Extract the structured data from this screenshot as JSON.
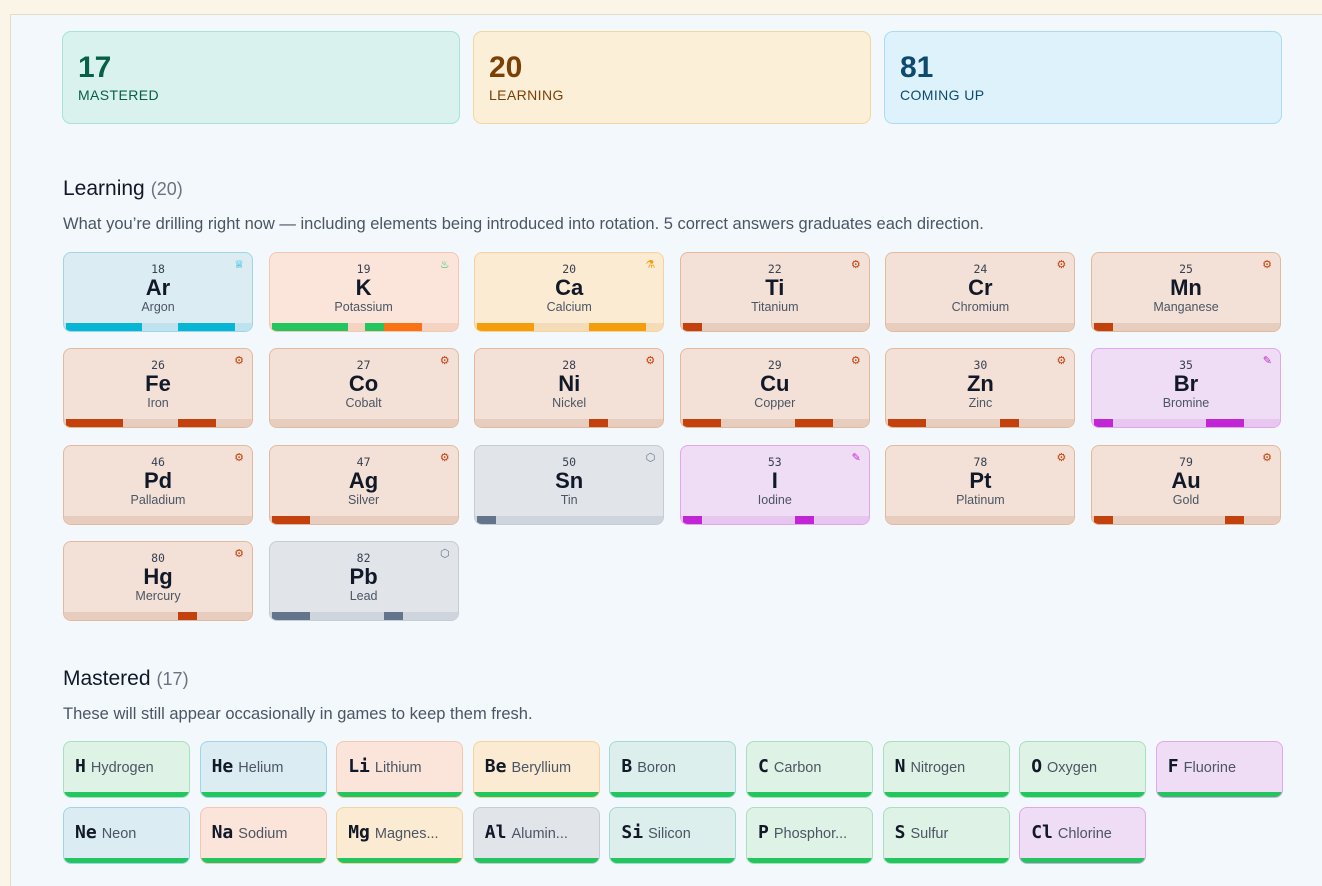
{
  "stats": [
    {
      "value": "17",
      "label": "MASTERED",
      "bg": "#d9f2ee",
      "border": "#a7e3d8",
      "fg": "#065f46"
    },
    {
      "value": "20",
      "label": "LEARNING",
      "bg": "#fcefd7",
      "border": "#f4d79c",
      "fg": "#7c3f06"
    },
    {
      "value": "81",
      "label": "COMING UP",
      "bg": "#def2fb",
      "border": "#a9dcf2",
      "fg": "#0c4a6e"
    }
  ],
  "learning": {
    "title": "Learning",
    "count": "(20)",
    "description": "What you’re drilling right now — including elements being introduced into rotation. 5 correct answers graduates each direction."
  },
  "mastered": {
    "title": "Mastered",
    "count": "(17)",
    "description": "These will still appear occasionally in games to keep them fresh."
  },
  "group_styles": {
    "noble": {
      "bg": "#dcecf3",
      "border": "#9fd5ea",
      "bar": "#06b6d4",
      "track": "#bfe3ee",
      "icon": "crown-icon",
      "glyph": "♕"
    },
    "alkali": {
      "bg": "#fbe5db",
      "border": "#f6c6b0",
      "bar": "#22c55e",
      "track": "#f4d3c3",
      "icon": "flame-icon",
      "glyph": "♨"
    },
    "alkaline": {
      "bg": "#fbebd3",
      "border": "#f5d39a",
      "bar": "#f59e0b",
      "track": "#f3dcb7",
      "icon": "flask-icon",
      "glyph": "⚗"
    },
    "transition": {
      "bg": "#f3e1d7",
      "border": "#e3b99c",
      "bar": "#c2410c",
      "track": "#e6cdbd",
      "icon": "gear-icon",
      "glyph": "⚙"
    },
    "halogen": {
      "bg": "#efdcf5",
      "border": "#e2a6ef",
      "bar": "#c026d3",
      "track": "#e7c6ef",
      "icon": "pencil-icon",
      "glyph": "✎"
    },
    "post": {
      "bg": "#e1e5ea",
      "border": "#c5ccd5",
      "bar": "#64748b",
      "track": "#cfd5dd",
      "icon": "cube-icon",
      "glyph": "⬡"
    }
  },
  "learning_elements": [
    {
      "number": "18",
      "symbol": "Ar",
      "name": "Argon",
      "group": "noble",
      "progress": [
        1,
        1,
        1,
        1,
        0,
        1,
        1,
        1
      ]
    },
    {
      "number": "19",
      "symbol": "K",
      "name": "Potassium",
      "group": "alkali",
      "progress": [
        1,
        1,
        1,
        1,
        1,
        2,
        2,
        0
      ]
    },
    {
      "number": "20",
      "symbol": "Ca",
      "name": "Calcium",
      "group": "alkaline",
      "progress": [
        1,
        1,
        1,
        0,
        0,
        1,
        1,
        1
      ]
    },
    {
      "number": "22",
      "symbol": "Ti",
      "name": "Titanium",
      "group": "transition",
      "progress": [
        1,
        0,
        0,
        0,
        0,
        0,
        0,
        0
      ]
    },
    {
      "number": "24",
      "symbol": "Cr",
      "name": "Chromium",
      "group": "transition",
      "progress": [
        0,
        0,
        0,
        0,
        0,
        0,
        0,
        0
      ]
    },
    {
      "number": "25",
      "symbol": "Mn",
      "name": "Manganese",
      "group": "transition",
      "progress": [
        1,
        0,
        0,
        0,
        0,
        0,
        0,
        0
      ]
    },
    {
      "number": "26",
      "symbol": "Fe",
      "name": "Iron",
      "group": "transition",
      "progress": [
        1,
        1,
        1,
        0,
        0,
        1,
        1,
        0
      ]
    },
    {
      "number": "27",
      "symbol": "Co",
      "name": "Cobalt",
      "group": "transition",
      "progress": [
        0,
        0,
        0,
        0,
        0,
        0,
        0,
        0
      ]
    },
    {
      "number": "28",
      "symbol": "Ni",
      "name": "Nickel",
      "group": "transition",
      "progress": [
        0,
        0,
        0,
        0,
        0,
        1,
        0,
        0
      ]
    },
    {
      "number": "29",
      "symbol": "Cu",
      "name": "Copper",
      "group": "transition",
      "progress": [
        1,
        1,
        0,
        0,
        0,
        1,
        1,
        0
      ]
    },
    {
      "number": "30",
      "symbol": "Zn",
      "name": "Zinc",
      "group": "transition",
      "progress": [
        1,
        1,
        0,
        0,
        0,
        1,
        0,
        0
      ]
    },
    {
      "number": "35",
      "symbol": "Br",
      "name": "Bromine",
      "group": "halogen",
      "progress": [
        1,
        0,
        0,
        0,
        0,
        1,
        1,
        0
      ]
    },
    {
      "number": "46",
      "symbol": "Pd",
      "name": "Palladium",
      "group": "transition",
      "progress": [
        0,
        0,
        0,
        0,
        0,
        0,
        0,
        0
      ]
    },
    {
      "number": "47",
      "symbol": "Ag",
      "name": "Silver",
      "group": "transition",
      "progress": [
        1,
        1,
        0,
        0,
        0,
        0,
        0,
        0
      ]
    },
    {
      "number": "50",
      "symbol": "Sn",
      "name": "Tin",
      "group": "post",
      "progress": [
        1,
        0,
        0,
        0,
        0,
        0,
        0,
        0
      ]
    },
    {
      "number": "53",
      "symbol": "I",
      "name": "Iodine",
      "group": "halogen",
      "progress": [
        1,
        0,
        0,
        0,
        0,
        1,
        0,
        0
      ]
    },
    {
      "number": "78",
      "symbol": "Pt",
      "name": "Platinum",
      "group": "transition",
      "progress": [
        0,
        0,
        0,
        0,
        0,
        0,
        0,
        0
      ]
    },
    {
      "number": "79",
      "symbol": "Au",
      "name": "Gold",
      "group": "transition",
      "progress": [
        1,
        0,
        0,
        0,
        0,
        0,
        1,
        0
      ]
    },
    {
      "number": "80",
      "symbol": "Hg",
      "name": "Mercury",
      "group": "transition",
      "progress": [
        0,
        0,
        0,
        0,
        0,
        1,
        0,
        0
      ]
    },
    {
      "number": "82",
      "symbol": "Pb",
      "name": "Lead",
      "group": "post",
      "progress": [
        1,
        1,
        0,
        0,
        0,
        1,
        0,
        0
      ]
    }
  ],
  "chip_styles": {
    "nonmetal": {
      "bg": "#dff2e6",
      "border": "#a7e0bd"
    },
    "noble": {
      "bg": "#dcecf3",
      "border": "#9fd5ea"
    },
    "alkali": {
      "bg": "#fbe5db",
      "border": "#f6c6b0"
    },
    "alkaline": {
      "bg": "#fbebd3",
      "border": "#f5d39a"
    },
    "metalloid": {
      "bg": "#dcefed",
      "border": "#a5d9d3"
    },
    "post": {
      "bg": "#e1e5ea",
      "border": "#c5ccd5"
    },
    "halogen": {
      "bg": "#efdcf5",
      "border": "#e2a6ef"
    }
  },
  "mastered_elements": [
    {
      "symbol": "H",
      "name": "Hydrogen",
      "group": "nonmetal"
    },
    {
      "symbol": "He",
      "name": "Helium",
      "group": "noble"
    },
    {
      "symbol": "Li",
      "name": "Lithium",
      "group": "alkali"
    },
    {
      "symbol": "Be",
      "name": "Beryllium",
      "group": "alkaline"
    },
    {
      "symbol": "B",
      "name": "Boron",
      "group": "metalloid"
    },
    {
      "symbol": "C",
      "name": "Carbon",
      "group": "nonmetal"
    },
    {
      "symbol": "N",
      "name": "Nitrogen",
      "group": "nonmetal"
    },
    {
      "symbol": "O",
      "name": "Oxygen",
      "group": "nonmetal"
    },
    {
      "symbol": "F",
      "name": "Fluorine",
      "group": "halogen"
    },
    {
      "symbol": "Ne",
      "name": "Neon",
      "group": "noble"
    },
    {
      "symbol": "Na",
      "name": "Sodium",
      "group": "alkali"
    },
    {
      "symbol": "Mg",
      "name": "Magnes...",
      "group": "alkaline"
    },
    {
      "symbol": "Al",
      "name": "Alumin...",
      "group": "post"
    },
    {
      "symbol": "Si",
      "name": "Silicon",
      "group": "metalloid"
    },
    {
      "symbol": "P",
      "name": "Phosphor...",
      "group": "nonmetal"
    },
    {
      "symbol": "S",
      "name": "Sulfur",
      "group": "nonmetal"
    },
    {
      "symbol": "Cl",
      "name": "Chlorine",
      "group": "halogen"
    }
  ]
}
